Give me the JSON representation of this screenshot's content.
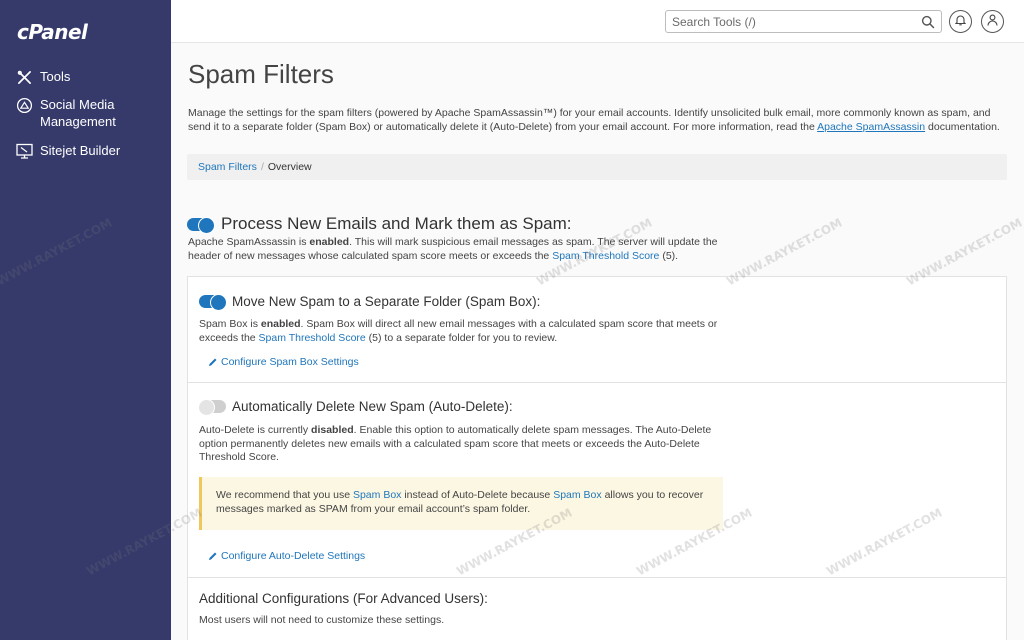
{
  "sidebar": {
    "logo": "cPanel",
    "items": [
      {
        "label": "Tools",
        "icon": "tools-icon"
      },
      {
        "label": "Social Media Management",
        "icon": "social-media-icon"
      },
      {
        "label": "Sitejet Builder",
        "icon": "sitejet-icon"
      }
    ]
  },
  "header": {
    "search_placeholder": "Search Tools (/)"
  },
  "page": {
    "title": "Spam Filters",
    "intro_text": "Manage the settings for the spam filters (powered by Apache SpamAssassin™) for your email accounts. Identify unsolicited bulk email, more commonly known as spam, and send it to a separate folder (Spam Box) or automatically delete it (Auto-Delete) from your email account. For more information, read the ",
    "intro_link": "Apache SpamAssassin",
    "intro_tail": " documentation.",
    "breadcrumb": {
      "parent": "Spam Filters",
      "separator": "/",
      "current": "Overview"
    }
  },
  "process": {
    "enabled": true,
    "heading": "Process New Emails and Mark them as Spam:",
    "desc_a": "Apache SpamAssassin is ",
    "desc_state": "enabled",
    "desc_b": ". This will mark suspicious email messages as spam. The server will update the header of new messages whose calculated spam score meets or exceeds the ",
    "desc_link": "Spam Threshold Score",
    "desc_c": " (5)."
  },
  "spam_box": {
    "enabled": true,
    "heading": "Move New Spam to a Separate Folder (Spam Box):",
    "desc_a": "Spam Box is ",
    "desc_state": "enabled",
    "desc_b": ". Spam Box will direct all new email messages with a calculated spam score that meets or exceeds the ",
    "desc_link": "Spam Threshold Score",
    "desc_c": " (5) to a separate folder for you to review.",
    "configure_label": "Configure Spam Box Settings"
  },
  "auto_delete": {
    "enabled": false,
    "heading": "Automatically Delete New Spam (Auto-Delete):",
    "desc_a": "Auto-Delete is currently ",
    "desc_state": "disabled",
    "desc_b": ". Enable this option to automatically delete spam messages. The Auto-Delete option permanently deletes new emails with a calculated spam score that meets or exceeds the Auto-Delete Threshold Score.",
    "warn_a": "We recommend that you use ",
    "warn_link1": "Spam Box",
    "warn_b": " instead of Auto-Delete because ",
    "warn_link2": "Spam Box",
    "warn_c": " allows you to recover messages marked as SPAM from your email account’s spam folder.",
    "configure_label": "Configure Auto-Delete Settings"
  },
  "advanced": {
    "heading": "Additional Configurations (For Advanced Users):",
    "desc": "Most users will not need to customize these settings."
  },
  "watermark": "WWW.RAYKET.COM",
  "colors": {
    "sidebar": "#363a6b",
    "link": "#1f76bc",
    "toggle_on": "#1f76bc",
    "warning_bg": "#fcf7e3",
    "warning_border": "#f0c75b"
  }
}
